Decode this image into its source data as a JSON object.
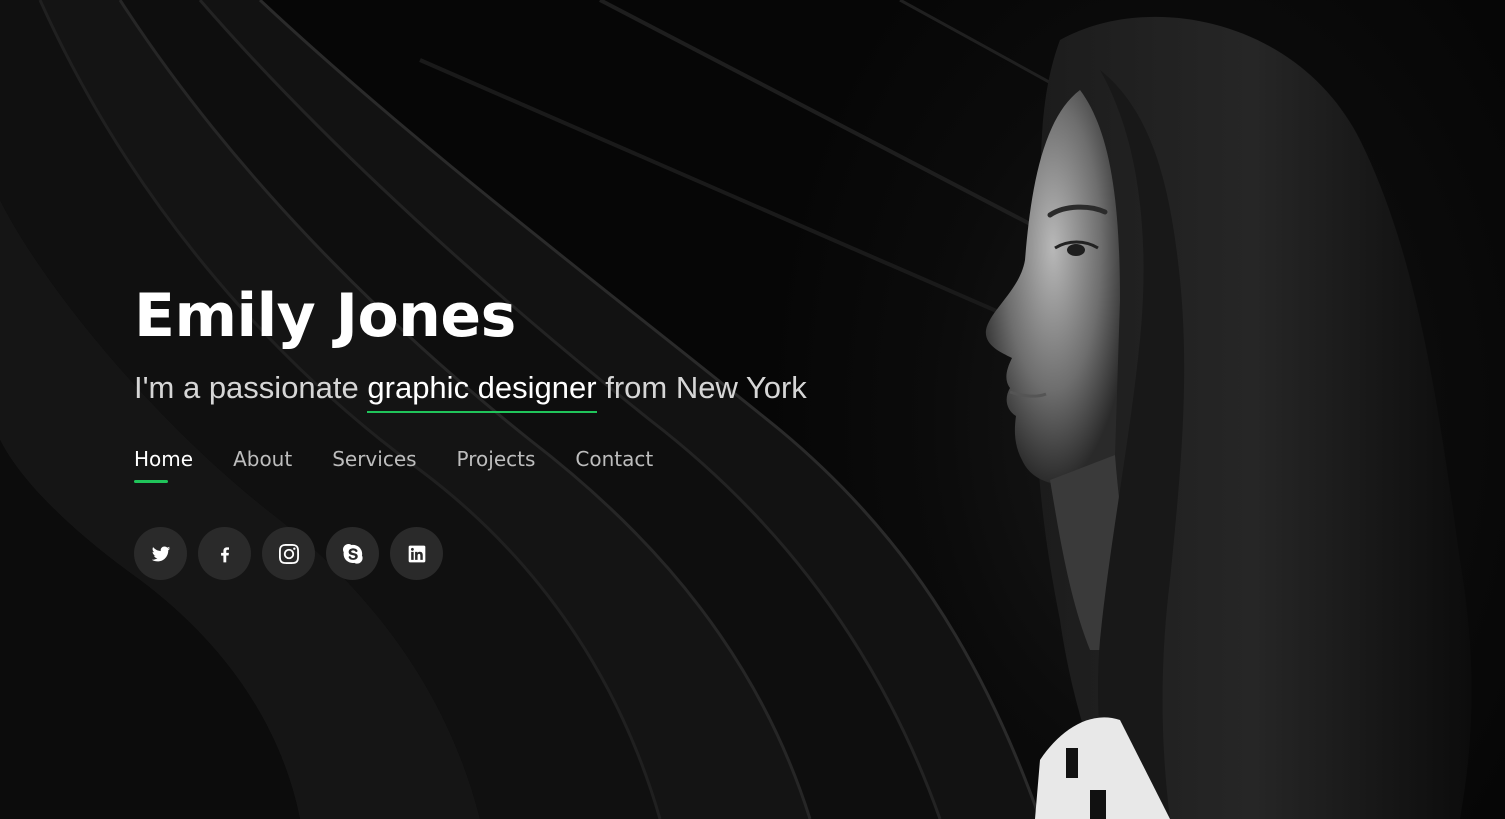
{
  "hero": {
    "name": "Emily Jones",
    "tagline": {
      "prefix": "I'm a passionate ",
      "highlight": "graphic designer",
      "suffix": " from New York"
    }
  },
  "nav": {
    "items": [
      {
        "label": "Home",
        "active": true
      },
      {
        "label": "About",
        "active": false
      },
      {
        "label": "Services",
        "active": false
      },
      {
        "label": "Projects",
        "active": false
      },
      {
        "label": "Contact",
        "active": false
      }
    ]
  },
  "social": {
    "icons": [
      "twitter-icon",
      "facebook-icon",
      "instagram-icon",
      "skype-icon",
      "linkedin-icon"
    ]
  },
  "colors": {
    "accent": "#20c45a",
    "background": "#070707",
    "text": "#ffffff",
    "muted_text": "#bdbdbd",
    "icon_bg": "#2a2a2a"
  }
}
